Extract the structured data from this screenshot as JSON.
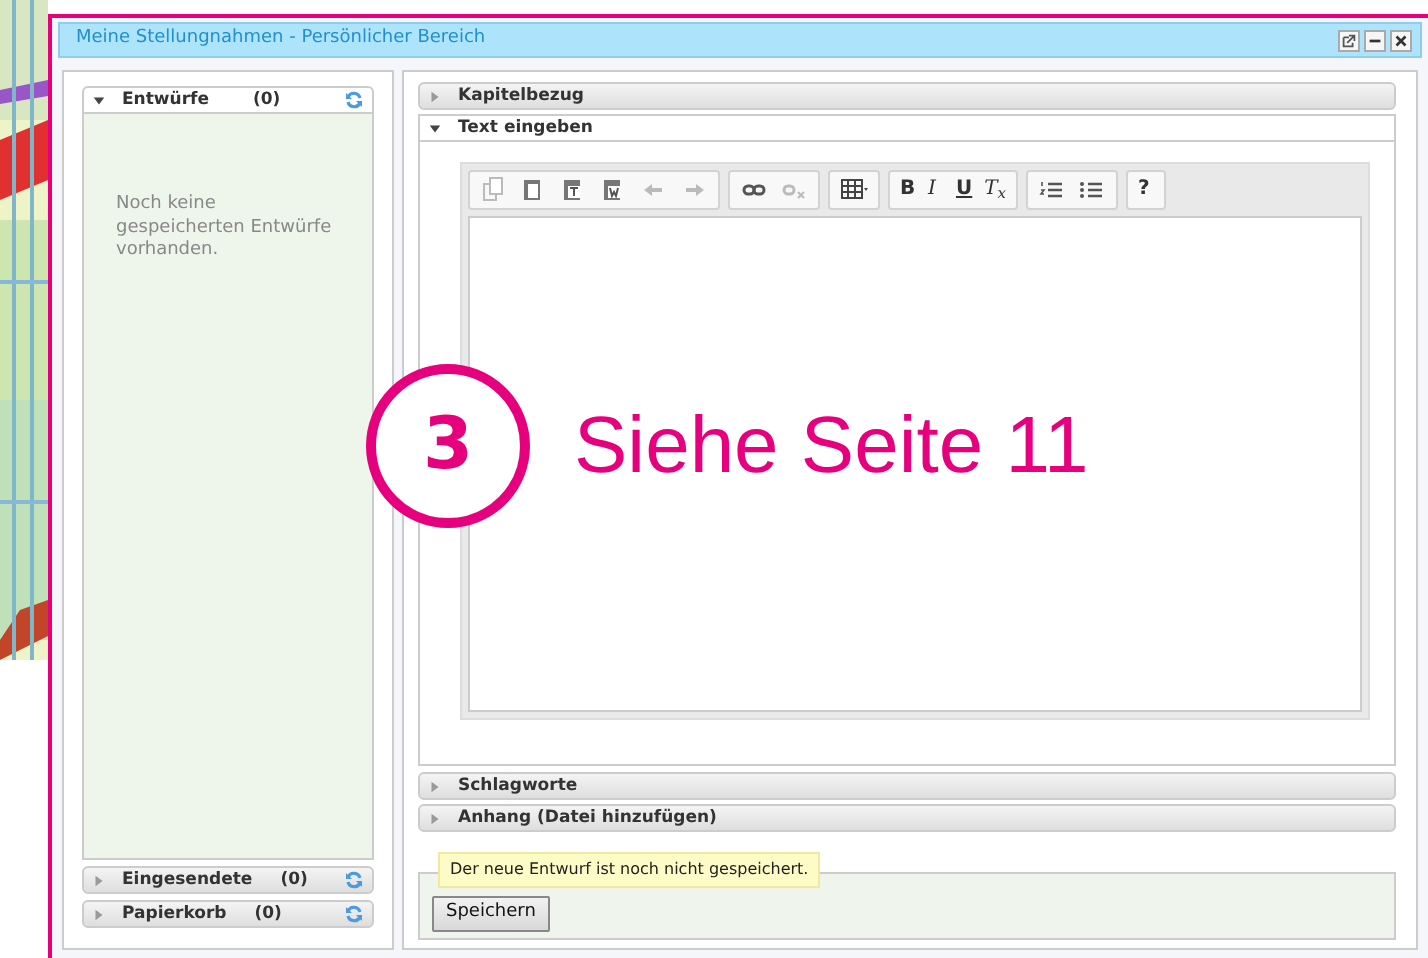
{
  "window": {
    "title": "Meine Stellungnahmen - Persönlicher Bereich"
  },
  "left_sections": [
    {
      "label": "Entwürfe",
      "count": "(0)",
      "expanded": true,
      "message": "Noch keine gespeicherten Entwürfe vorhanden."
    },
    {
      "label": "Eingesendete",
      "count": "(0)",
      "expanded": false
    },
    {
      "label": "Papierkorb",
      "count": "(0)",
      "expanded": false
    }
  ],
  "right_sections_top": [
    {
      "label": "Kapitelbezug",
      "expanded": false
    },
    {
      "label": "Text eingeben",
      "expanded": true
    }
  ],
  "format_buttons": [
    "B",
    "I",
    "U",
    "T$_{x}$"
  ],
  "help_button": "?",
  "right_sections_bottom": [
    {
      "label": "Schlagworte",
      "expanded": false
    },
    {
      "label": "Anhang (Datei hinzufügen)",
      "expanded": false
    }
  ],
  "notice": "Der neue Entwurf ist noch nicht gespeichert.",
  "save_button": "Speichern",
  "annotation": {
    "number": "3",
    "text": "Siehe Seite 11"
  }
}
